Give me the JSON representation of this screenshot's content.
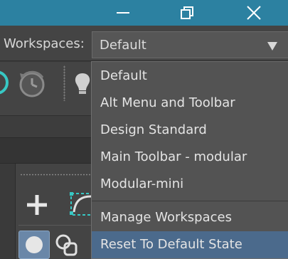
{
  "window_controls": {
    "minimize_icon": "minimize-icon",
    "maximize_icon": "restore-icon",
    "close_icon": "close-icon"
  },
  "workspaces": {
    "label": "Workspaces:",
    "selected": "Default",
    "arrow_icon": "dropdown-arrow-icon"
  },
  "menu": {
    "items": [
      {
        "label": "Default"
      },
      {
        "label": "Alt Menu and Toolbar"
      },
      {
        "label": "Design Standard"
      },
      {
        "label": "Main Toolbar - modular"
      },
      {
        "label": "Modular-mini"
      }
    ],
    "actions": [
      {
        "label": "Manage Workspaces"
      },
      {
        "label": "Reset To Default State"
      }
    ],
    "highlighted": "Reset To Default State"
  },
  "colors": {
    "titlebar": "#2c81a1",
    "highlight": "#4b6a8c",
    "accent_teal": "#37c8c4",
    "selected_tool": "#6a87a8"
  }
}
